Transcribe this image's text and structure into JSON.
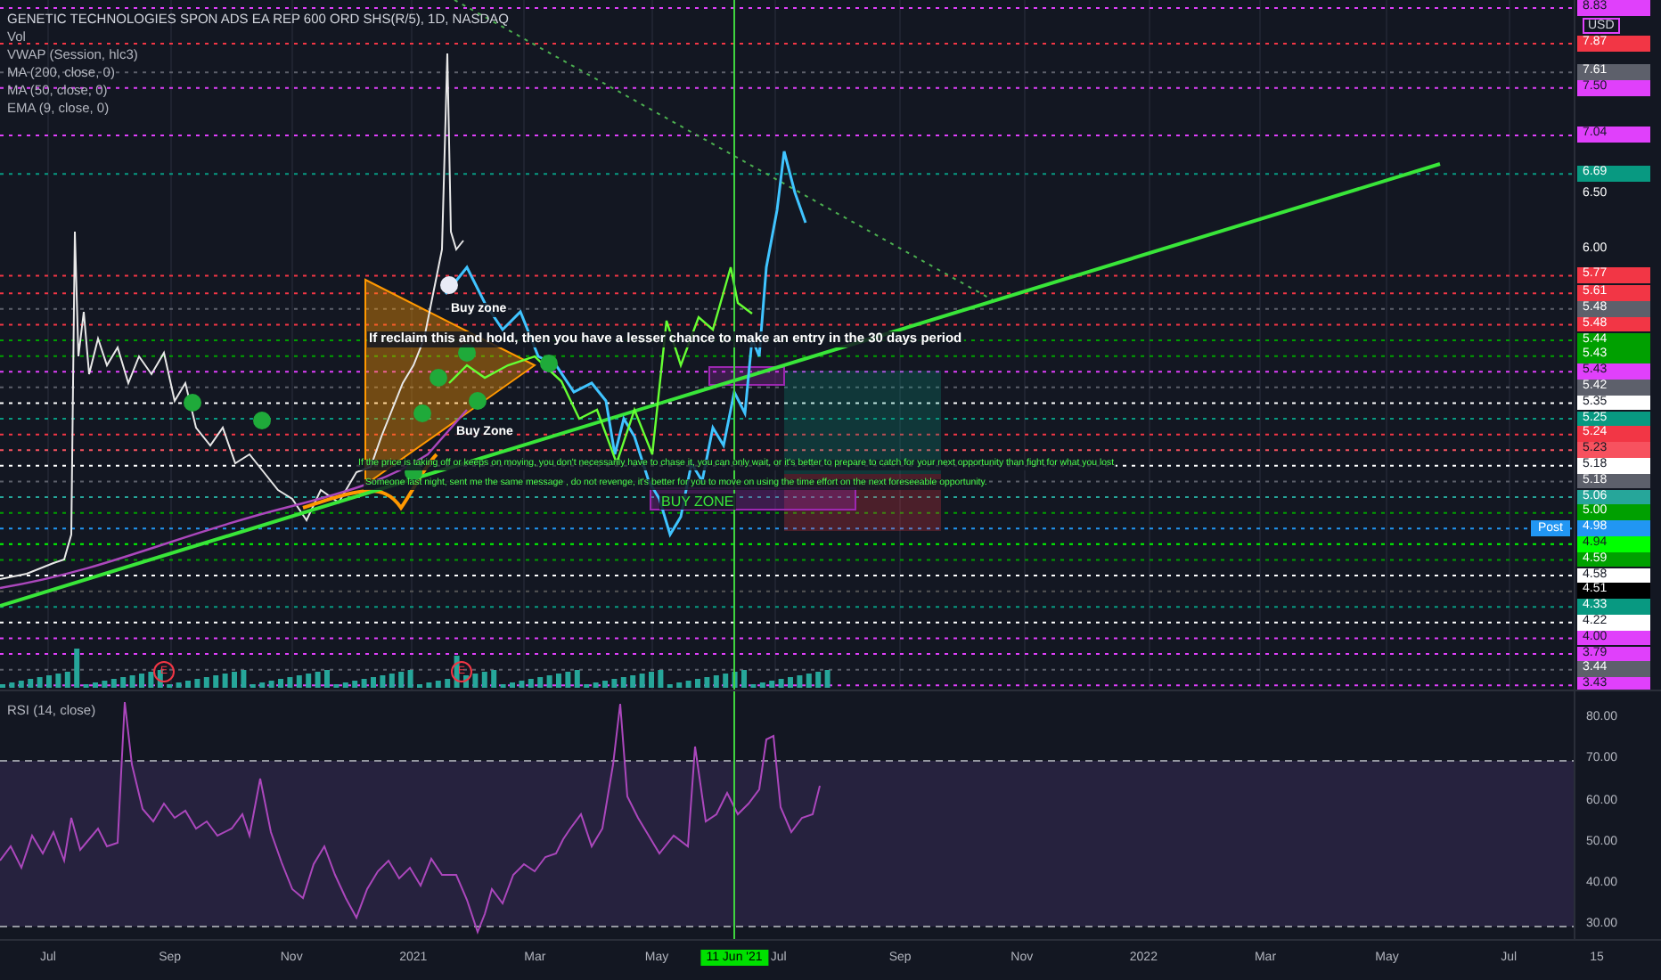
{
  "legend": {
    "title": "GENETIC TECHNOLOGIES SPON ADS EA REP 600 ORD SHS(R/5), 1D, NASDAQ",
    "indicators": [
      "Vol",
      "VWAP (Session, hlc3)",
      "MA (200, close, 0)",
      "MA (50, close, 0)",
      "EMA (9, close, 0)"
    ]
  },
  "annotations": [
    {
      "kind": "label",
      "text": "Buy zone"
    },
    {
      "kind": "headline",
      "text": "If reclaim this and hold, then you have a lesser chance to make an entry in the 30 days period"
    },
    {
      "kind": "label",
      "text": "Buy Zone"
    },
    {
      "kind": "note",
      "text": "If the price is taking off or keeps on moving, you don't necessarily have to chase it, you can only wait, or it's better to prepare to catch for your next opportunity than fight for what you lost"
    },
    {
      "kind": "note",
      "text": "Someone last night, sent me the same message , do not revenge, it's better for you to move on using the time effort on the next foreseeable opportunity."
    },
    {
      "kind": "zone",
      "text": "BUY ZONE"
    }
  ],
  "earnings_marks": [
    "E",
    "E"
  ],
  "price_axis": {
    "currency": "USD",
    "labels": [
      {
        "text": "8.83",
        "color": "#e040fb"
      },
      {
        "text": "7.87",
        "color": "#f23645"
      },
      {
        "text": "7.61",
        "color": "#5d606b"
      },
      {
        "text": "7.50",
        "color": "#e040fb"
      },
      {
        "text": "7.04",
        "color": "#e040fb"
      },
      {
        "text": "6.69",
        "color": "#089981"
      },
      {
        "text": "6.50"
      },
      {
        "text": "6.00"
      },
      {
        "text": "5.77",
        "color": "#f23645"
      },
      {
        "text": "5.61",
        "color": "#f23645"
      },
      {
        "text": "5.48",
        "color": "#5d606b"
      },
      {
        "text": "5.48",
        "color": "#f23645"
      },
      {
        "text": "5.44",
        "color": "#00a000"
      },
      {
        "text": "5.43",
        "color": "#00a000"
      },
      {
        "text": "5.43",
        "color": "#e040fb"
      },
      {
        "text": "5.42",
        "color": "#5d606b"
      },
      {
        "text": "5.35",
        "color": "#ffffff"
      },
      {
        "text": "5.25",
        "color": "#089981"
      },
      {
        "text": "5.24",
        "color": "#f23645"
      },
      {
        "text": "5.23",
        "color": "#f7525f"
      },
      {
        "text": "5.18",
        "color": "#ffffff"
      },
      {
        "text": "5.18",
        "color": "#5d606b"
      },
      {
        "text": "5.06",
        "color": "#26a69a"
      },
      {
        "text": "5.00",
        "color": "#00a000"
      },
      {
        "text": "4.98",
        "color": "#2196f3",
        "tag": "Post"
      },
      {
        "text": "4.94",
        "color": "#00ff00"
      },
      {
        "text": "4.59",
        "color": "#00a000"
      },
      {
        "text": "4.58",
        "color": "#ffffff"
      },
      {
        "text": "4.51",
        "color": "#000000"
      },
      {
        "text": "4.33",
        "color": "#089981"
      },
      {
        "text": "4.22",
        "color": "#ffffff"
      },
      {
        "text": "4.00",
        "color": "#e040fb"
      },
      {
        "text": "3.79",
        "color": "#e040fb"
      },
      {
        "text": "3.44",
        "color": "#5d606b"
      },
      {
        "text": "3.43",
        "color": "#e040fb"
      }
    ]
  },
  "rsi": {
    "title": "RSI (14, close)",
    "ticks": [
      "80.00",
      "70.00",
      "60.00",
      "50.00",
      "40.00",
      "30.00"
    ]
  },
  "time_axis": [
    {
      "text": "Jul",
      "selected": false
    },
    {
      "text": "Sep",
      "selected": false
    },
    {
      "text": "Nov",
      "selected": false
    },
    {
      "text": "2021",
      "selected": false
    },
    {
      "text": "Mar",
      "selected": false
    },
    {
      "text": "May",
      "selected": false
    },
    {
      "text": "11 Jun '21",
      "selected": true
    },
    {
      "text": "Jul",
      "selected": false
    },
    {
      "text": "Sep",
      "selected": false
    },
    {
      "text": "Nov",
      "selected": false
    },
    {
      "text": "2022",
      "selected": false
    },
    {
      "text": "Mar",
      "selected": false
    },
    {
      "text": "May",
      "selected": false
    },
    {
      "text": "Jul",
      "selected": false
    },
    {
      "text": "15",
      "selected": false
    }
  ]
}
